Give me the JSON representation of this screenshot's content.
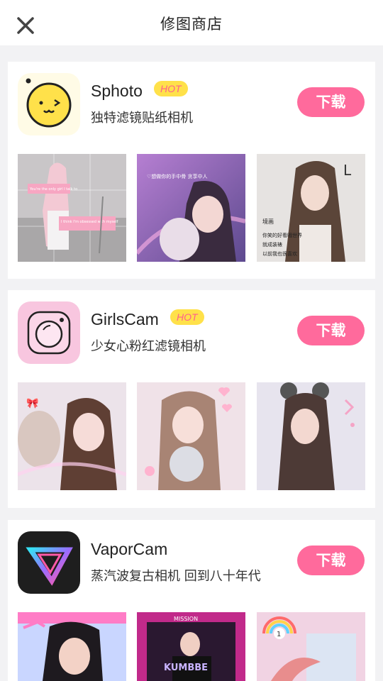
{
  "header": {
    "title": "修图商店"
  },
  "apps": [
    {
      "name": "Sphoto",
      "badge": "HOT",
      "description": "独特滤镜贴纸相机",
      "download_label": "下载",
      "thumb_texts": [
        "You're the only girl I talk to",
        "I think I'm obsessed with myself",
        "♡想做你的手中骨 贪享中人",
        "境画",
        "你笑的好看哦世界",
        "就成装裱",
        "以前我也很喜欢"
      ]
    },
    {
      "name": "GirlsCam",
      "badge": "HOT",
      "description": "少女心粉红滤镜相机",
      "download_label": "下载"
    },
    {
      "name": "VaporCam",
      "badge": "",
      "description": "蒸汽波复古相机 回到八十年代",
      "download_label": "下载",
      "thumb_texts": [
        "MISSION",
        "KUMBBE",
        "1"
      ]
    }
  ],
  "colors": {
    "accent": "#ff6a9c",
    "badge_bg": "#ffe14a",
    "badge_text": "#ff5f8d"
  }
}
